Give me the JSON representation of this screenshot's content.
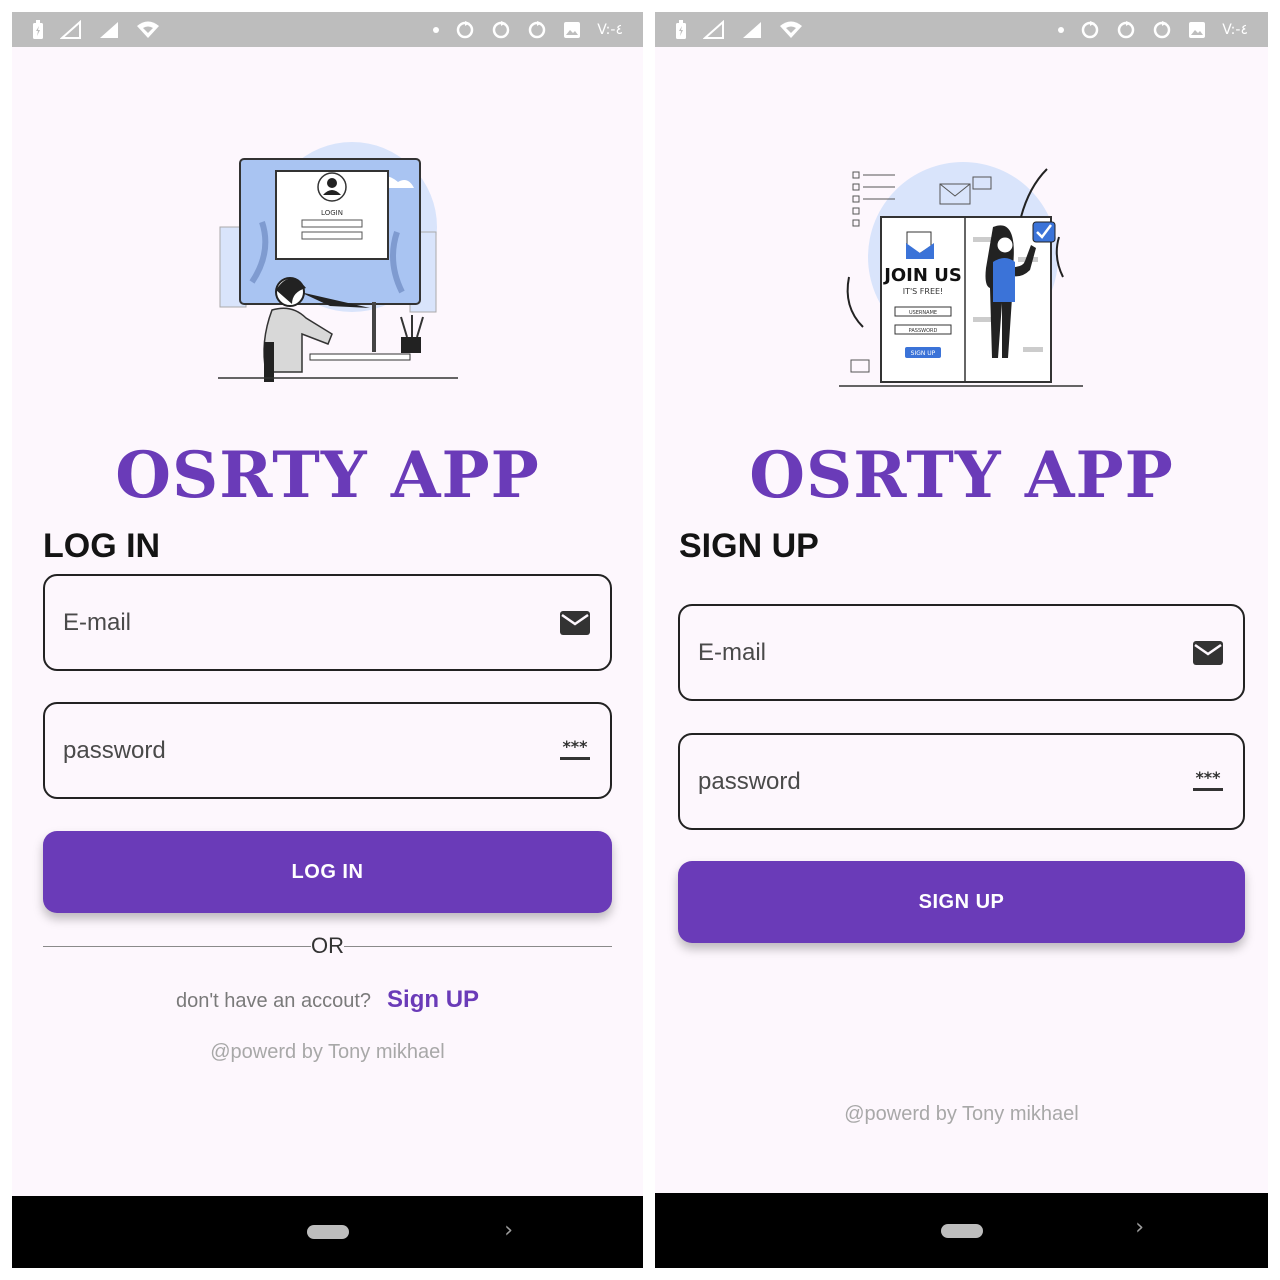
{
  "status_bar": {
    "time": "V:-٤"
  },
  "login_screen": {
    "app_title": "OSRTY APP",
    "heading": "LOG IN",
    "email_placeholder": "E-mail",
    "password_placeholder": "password",
    "submit_label": "LOG IN",
    "divider_text": "OR",
    "no_account_text": "don't have an accout?",
    "signup_link": "Sign UP",
    "credit": "@powerd by Tony mikhael",
    "illustration": {
      "login_label": "LOGIN"
    }
  },
  "signup_screen": {
    "app_title": "OSRTY APP",
    "heading": "SIGN UP",
    "email_placeholder": "E-mail",
    "password_placeholder": "password",
    "submit_label": "SIGN UP",
    "credit": "@powerd by Tony mikhael",
    "illustration": {
      "join_title": "JOIN US",
      "join_subtitle": "IT'S FREE!",
      "field1": "USERNAME",
      "field2": "PASSWORD",
      "button": "SIGN UP"
    }
  },
  "colors": {
    "accent": "#6a3bb8",
    "background": "#fdf7fd",
    "status_bar": "#bdbdbd",
    "nav_bar": "#000000"
  },
  "icons": [
    "battery-icon",
    "signal-icon",
    "wifi-icon",
    "sync-icon",
    "image-icon",
    "mail-icon",
    "password-icon",
    "home-pill-icon",
    "chevron-right-icon"
  ]
}
